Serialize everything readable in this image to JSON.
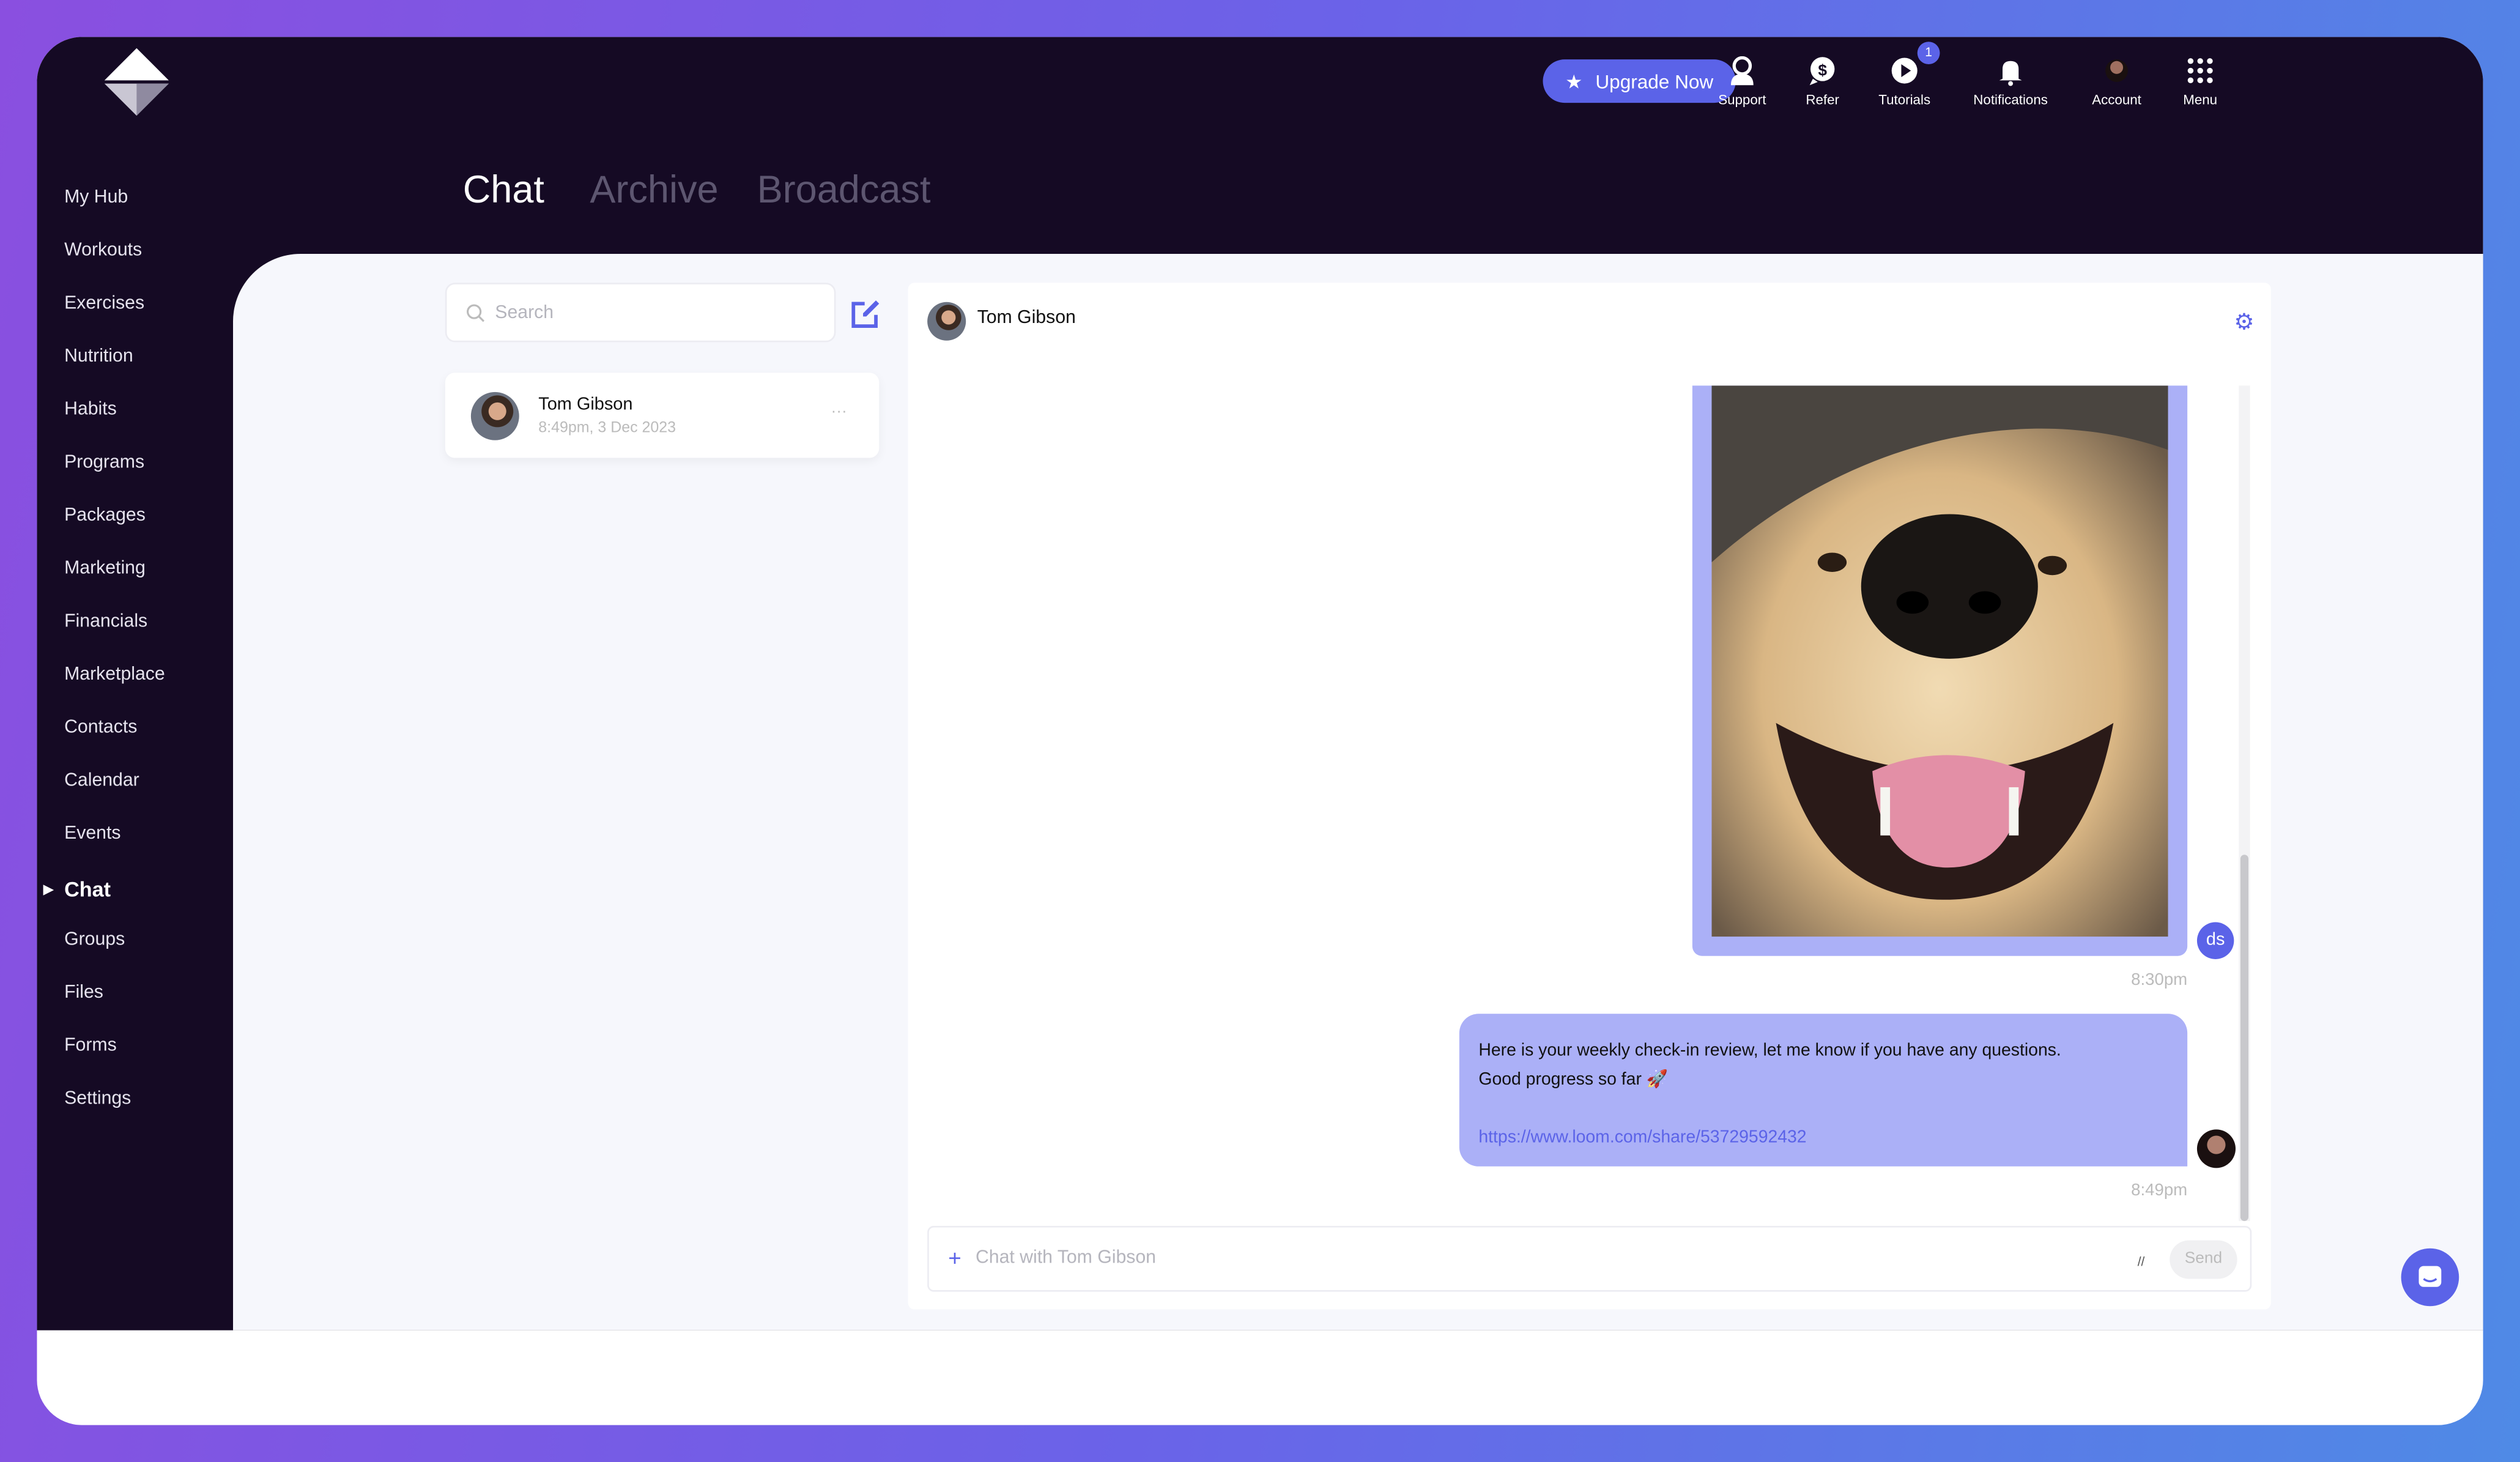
{
  "header": {
    "upgrade_label": "Upgrade Now",
    "nav": [
      {
        "label": "Support",
        "icon": "support-icon"
      },
      {
        "label": "Refer",
        "icon": "refer-dollar-icon"
      },
      {
        "label": "Tutorials",
        "icon": "play-icon",
        "badge": "1"
      },
      {
        "label": "Notifications",
        "icon": "bell-icon"
      },
      {
        "label": "Account",
        "icon": "account-avatar"
      },
      {
        "label": "Menu",
        "icon": "grid-dots-icon"
      }
    ]
  },
  "sidebar": {
    "items": [
      "My Hub",
      "Workouts",
      "Exercises",
      "Nutrition",
      "Habits",
      "Programs",
      "Packages",
      "Marketing",
      "Financials",
      "Marketplace",
      "Contacts",
      "Calendar",
      "Events",
      "Chat",
      "Groups",
      "Files",
      "Forms",
      "Settings"
    ],
    "active": "Chat"
  },
  "tabs": [
    "Chat",
    "Archive",
    "Broadcast"
  ],
  "search": {
    "placeholder": "Search"
  },
  "conversations": [
    {
      "name": "Tom Gibson",
      "time": "8:49pm, 3 Dec 2023"
    }
  ],
  "chat": {
    "contact": "Tom Gibson",
    "messages": [
      {
        "type": "image",
        "sender_initials": "ds",
        "time": "8:30pm"
      },
      {
        "type": "text",
        "line1": "Here is your weekly check-in review, let me know if you have any questions.",
        "line2": "Good progress so far 🚀",
        "link": "https://www.loom.com/share/53729592432",
        "time": "8:49pm"
      }
    ],
    "input_placeholder": "Chat with Tom Gibson",
    "send_label": "Send"
  },
  "colors": {
    "accent": "#5b63e8",
    "bubble": "#abb0f7",
    "dark": "#150a24"
  }
}
